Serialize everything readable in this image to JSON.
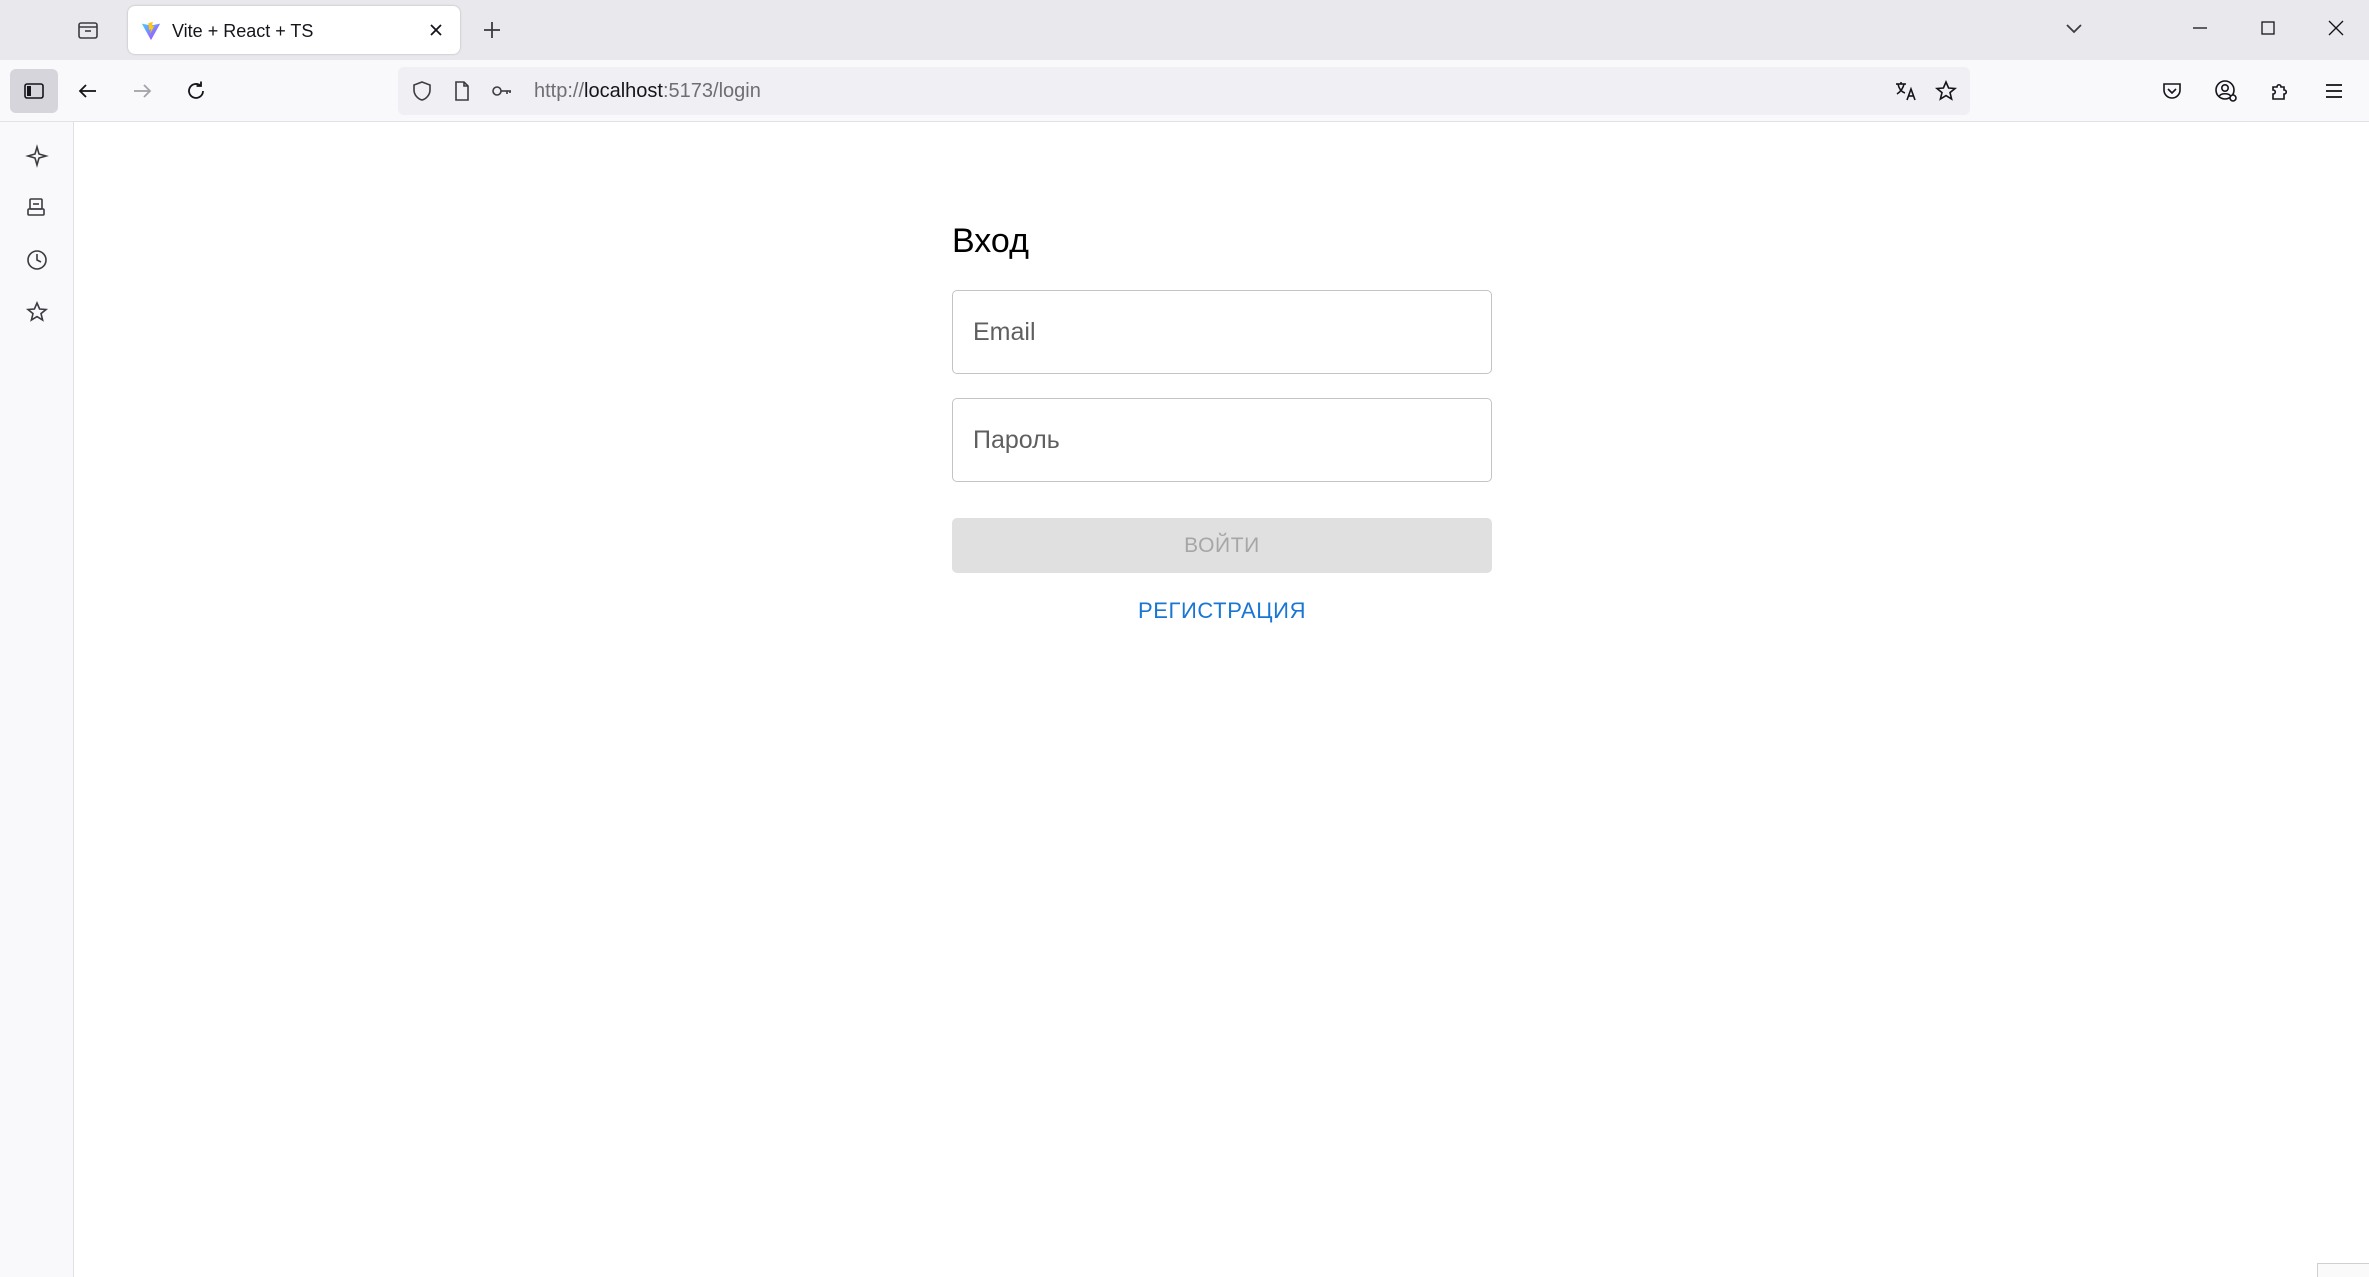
{
  "browser": {
    "tab": {
      "title": "Vite + React + TS",
      "favicon": "vite-logo-icon"
    },
    "url": {
      "scheme": "http://",
      "host": "localhost",
      "rest": ":5173/login"
    },
    "icons": {
      "tab_list": "tab-list-icon",
      "new_tab": "plus-icon",
      "overflow": "chevron-down-icon",
      "sidebar_toggle": "sidebar-icon",
      "back": "arrow-left-icon",
      "forward": "arrow-right-icon",
      "reload": "reload-icon",
      "translate": "translate-icon",
      "bookmark": "star-icon",
      "pocket": "pocket-icon",
      "account": "account-icon",
      "extensions": "puzzle-icon",
      "menu": "hamburger-icon"
    },
    "sidebar": [
      {
        "name": "ai-chatbot",
        "icon": "sparkle-icon"
      },
      {
        "name": "synced-tabs",
        "icon": "synced-tabs-icon"
      },
      {
        "name": "history",
        "icon": "clock-icon"
      },
      {
        "name": "bookmarks",
        "icon": "star-icon"
      }
    ]
  },
  "page": {
    "title": "Вход",
    "email_placeholder": "Email",
    "password_placeholder": "Пароль",
    "login_button": "ВОЙТИ",
    "register_link": "РЕГИСТРАЦИЯ"
  },
  "colors": {
    "accent_link": "#1976d2",
    "disabled_button_bg": "#e0e0e0",
    "disabled_button_text": "#a6a6a6",
    "chrome_bg": "#e9e9ed"
  }
}
